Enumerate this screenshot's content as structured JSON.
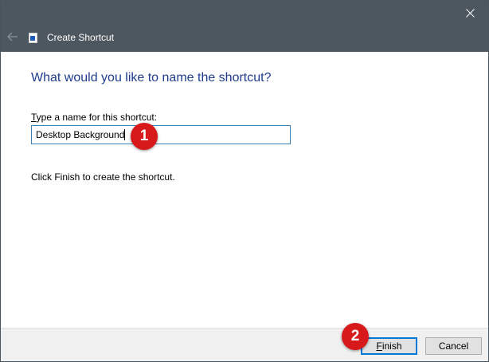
{
  "window": {
    "title": "Create Shortcut",
    "titlebar_color": "#4d575f"
  },
  "dialog": {
    "heading": "What would you like to name the shortcut?",
    "field_label_mnemonic": "T",
    "field_label_rest": "ype a name for this shortcut:",
    "name_value": "Desktop Background",
    "hint": "Click Finish to create the shortcut."
  },
  "buttons": {
    "finish_mnemonic": "F",
    "finish_rest": "inish",
    "cancel": "Cancel"
  },
  "annotations": {
    "step_1": "1",
    "step_2": "2",
    "color": "#d7191c"
  },
  "icons": {
    "close": "close-icon",
    "back": "back-arrow-icon",
    "app": "shortcut-icon"
  }
}
